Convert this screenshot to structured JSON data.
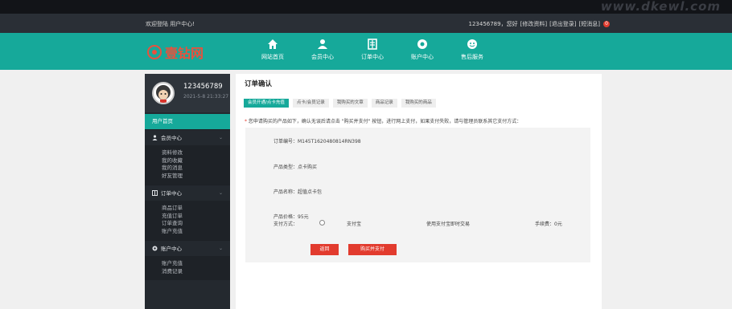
{
  "watermark": "www.dkewl.com",
  "userbar": {
    "welcome": "欢迎登陆 用户中心!",
    "username_greeting": "123456789，您好",
    "edit_profile": "[修改资料]",
    "logout": "[退出登录]",
    "messages": "[短消息]",
    "message_count": "0"
  },
  "logo": {
    "text": "壹钻网"
  },
  "nav": {
    "items": [
      {
        "label": "网站首页",
        "icon": "home-icon"
      },
      {
        "label": "会员中心",
        "icon": "user-icon"
      },
      {
        "label": "订单中心",
        "icon": "order-list-icon"
      },
      {
        "label": "账户中心",
        "icon": "account-icon"
      },
      {
        "label": "售后服务",
        "icon": "service-icon"
      }
    ]
  },
  "sidebar": {
    "username": "123456789",
    "time": "2021-5-8 21:33:27",
    "home_label": "用户首页",
    "sections": [
      {
        "title": "会员中心",
        "icon": "user-icon",
        "items": [
          "资料修改",
          "我的收藏",
          "我的消息",
          "好友管理"
        ]
      },
      {
        "title": "订单中心",
        "icon": "order-list-icon",
        "items": [
          "商品订单",
          "充值订单",
          "订单查询",
          "账户充值"
        ]
      },
      {
        "title": "账户中心",
        "icon": "gear-icon",
        "items": [
          "账户充值",
          "消费记录"
        ]
      }
    ]
  },
  "content": {
    "title": "订单确认",
    "tabs": [
      {
        "label": "会员开通/点卡充值",
        "active": true
      },
      {
        "label": "点卡/会员记录",
        "active": false
      },
      {
        "label": "我购买的文章",
        "active": false
      },
      {
        "label": "商品记录",
        "active": false
      },
      {
        "label": "我购买的商品",
        "active": false
      }
    ],
    "notice_star": "*",
    "notice": "您申请购买的产品如下，确认无误后请点击 \"购买并支付\" 按钮，进行网上支付，如果支付失败，请与管理员联系其它支付方式：",
    "order_no": "订单编号：M145T1620480814RN398",
    "product_type": "产品类型：点卡购买",
    "product_name": "产品名称：超值点卡包",
    "product_price": "产品价格：95元",
    "pay_method_label": "支付方式：",
    "pay_option": "支付宝",
    "pay_desc": "使用支付宝即时交易",
    "fee": "手续费：0元",
    "back_button": "返回",
    "buy_button": "购买并支付"
  },
  "colors": {
    "accent": "#16a99a",
    "danger": "#e23b2e",
    "sidebar_bg": "#24292f",
    "topbar_bg": "#2a2f36"
  }
}
